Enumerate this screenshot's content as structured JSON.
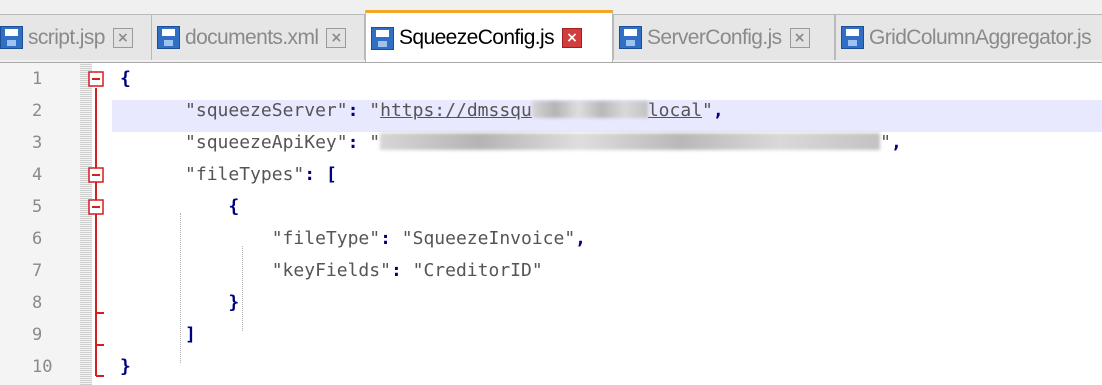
{
  "tabs": [
    {
      "label": "script.jsp",
      "close": "×",
      "active": false
    },
    {
      "label": "documents.xml",
      "close": "×",
      "active": false
    },
    {
      "label": "SqueezeConfig.js",
      "close": "×",
      "active": true
    },
    {
      "label": "ServerConfig.js",
      "close": "×",
      "active": false
    },
    {
      "label": "GridColumnAggregator.js",
      "close": "×",
      "active": false
    }
  ],
  "editor": {
    "line_numbers": [
      "1",
      "2",
      "3",
      "4",
      "5",
      "6",
      "7",
      "8",
      "9",
      "10"
    ],
    "current_line": 2,
    "lines": {
      "l1_brace": "{",
      "l2_key": "\"squeezeServer\"",
      "l2_colon": ": ",
      "l2_quote_open": "\"",
      "l2_url_start": "https://dmssqu",
      "l2_url_end": "local",
      "l2_quote_close": "\"",
      "l2_comma": ",",
      "l3_key": "\"squeezeApiKey\"",
      "l3_colon": ": ",
      "l3_quote_open": "\"",
      "l3_quote_close": "\"",
      "l3_comma": ",",
      "l4_key": "\"fileTypes\"",
      "l4_colon": ": ",
      "l4_bracket": "[",
      "l5_brace": "{",
      "l6_key": "\"fileType\"",
      "l6_colon": ": ",
      "l6_value": "\"SqueezeInvoice\"",
      "l6_comma": ",",
      "l7_key": "\"keyFields\"",
      "l7_colon": ": ",
      "l7_value": "\"CreditorID\"",
      "l8_brace": "}",
      "l9_bracket": "]",
      "l10_brace": "}"
    }
  },
  "icons": {
    "tab_file_icon": "floppy-disk-icon",
    "tab_close_icon": "close-x-icon",
    "fold_expanded_icon": "fold-minus-icon"
  },
  "colors": {
    "active_tab_accent": "#f5a623",
    "active_close_button": "#d23c3c",
    "operator": "#000080",
    "string": "#808080",
    "fold_marker": "#d21f1f",
    "current_line_highlight": "#e8e8ff"
  }
}
